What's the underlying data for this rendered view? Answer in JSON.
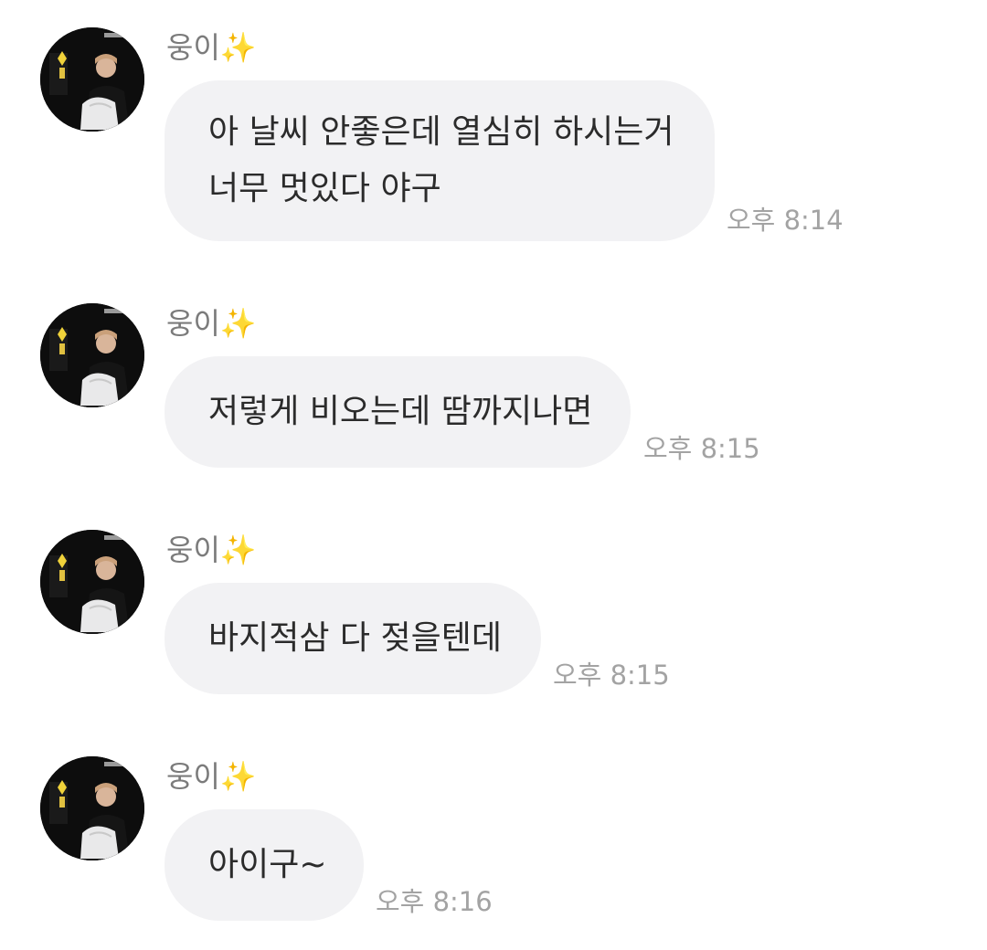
{
  "sender_name": "웅이✨",
  "messages": [
    {
      "lines": [
        "아 날씨 안좋은데 열심히 하시는거",
        "너무 멋있다 야구"
      ],
      "time": "오후 8:14"
    },
    {
      "lines": [
        "저렇게 비오는데 땀까지나면"
      ],
      "time": "오후 8:15"
    },
    {
      "lines": [
        "바지적삼 다 젖을텐데"
      ],
      "time": "오후 8:15"
    },
    {
      "lines": [
        "아이구~"
      ],
      "time": "오후 8:16"
    }
  ],
  "avatar_icon": "profile-photo-avatar",
  "colors": {
    "bubble": "#f2f2f4",
    "text": "#2b2b2b",
    "sender": "#7b7b7b",
    "time": "#a3a3a3"
  }
}
